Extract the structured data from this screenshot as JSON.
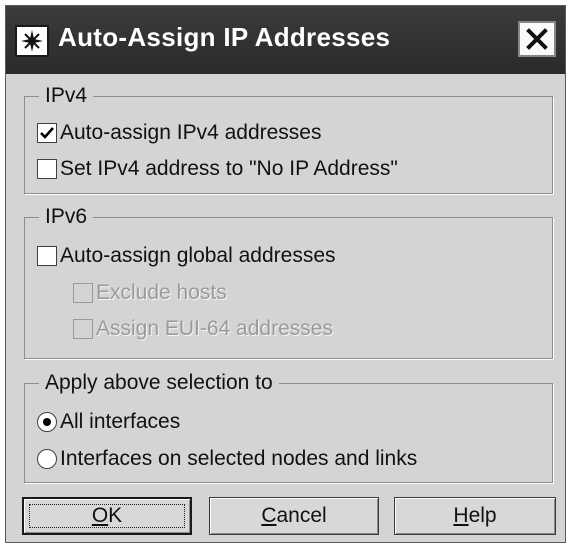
{
  "window": {
    "title": "Auto-Assign IP Addresses"
  },
  "ipv4": {
    "legend": "IPv4",
    "options": [
      {
        "label": "Auto-assign IPv4 addresses",
        "checked": true
      },
      {
        "label": "Set IPv4 address to \"No IP Address\"",
        "checked": false
      }
    ]
  },
  "ipv6": {
    "legend": "IPv6",
    "options": [
      {
        "label": "Auto-assign global addresses",
        "checked": false,
        "enabled": true
      },
      {
        "label": "Exclude hosts",
        "checked": false,
        "enabled": false
      },
      {
        "label": "Assign EUI-64 addresses",
        "checked": false,
        "enabled": false
      }
    ]
  },
  "apply": {
    "legend": "Apply above selection to",
    "options": [
      {
        "label": "All interfaces",
        "selected": true
      },
      {
        "label": "Interfaces on selected nodes and links",
        "selected": false
      }
    ]
  },
  "buttons": {
    "ok": {
      "label": "OK",
      "underline": "O",
      "rest": "K"
    },
    "cancel": {
      "label": "Cancel",
      "underline": "C",
      "rest": "ancel"
    },
    "help": {
      "label": "Help",
      "underline": "H",
      "rest": "elp"
    }
  },
  "icons": {
    "app": "star-icon",
    "close": "close-icon",
    "check": "checkmark-icon"
  }
}
